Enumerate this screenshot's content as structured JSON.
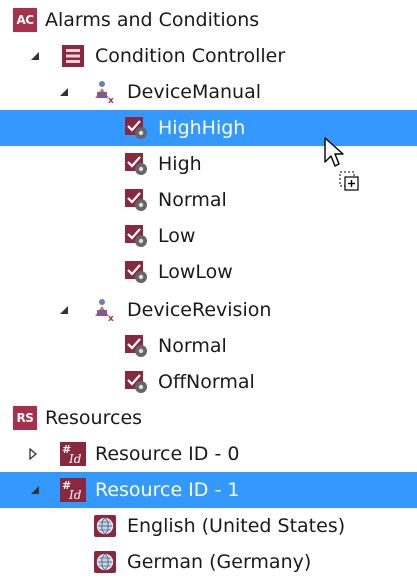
{
  "tree": {
    "root_alarms": {
      "label": "Alarms and Conditions",
      "badge": "AC",
      "icon": "alarms-conditions-badge-icon"
    },
    "condition_controller": {
      "label": "Condition Controller",
      "icon": "condition-controller-icon",
      "expanded": true
    },
    "device_manual": {
      "label": "DeviceManual",
      "icon": "device-icon",
      "expanded": true,
      "children": [
        {
          "label": "HighHigh",
          "icon": "condition-state-icon",
          "selected": true
        },
        {
          "label": "High",
          "icon": "condition-state-icon"
        },
        {
          "label": "Normal",
          "icon": "condition-state-icon"
        },
        {
          "label": "Low",
          "icon": "condition-state-icon"
        },
        {
          "label": "LowLow",
          "icon": "condition-state-icon"
        }
      ]
    },
    "device_revision": {
      "label": "DeviceRevision",
      "icon": "device-icon",
      "expanded": true,
      "children": [
        {
          "label": "Normal",
          "icon": "condition-state-icon"
        },
        {
          "label": "OffNormal",
          "icon": "condition-state-icon"
        }
      ]
    },
    "root_resources": {
      "label": "Resources",
      "badge": "RS",
      "icon": "resources-badge-icon"
    },
    "resource_0": {
      "label": "Resource ID - 0",
      "icon": "resource-id-icon",
      "expanded": false
    },
    "resource_1": {
      "label": "Resource ID - 1",
      "icon": "resource-id-icon",
      "expanded": true,
      "highlighted": true,
      "children": [
        {
          "label": "English (United States)",
          "icon": "language-globe-icon"
        },
        {
          "label": "German (Germany)",
          "icon": "language-globe-icon"
        }
      ]
    }
  },
  "colors": {
    "selection": "#3399ff",
    "badge": "#a8304a",
    "expander": "#333333"
  },
  "cursor": {
    "icon": "drag-copy-cursor-icon"
  }
}
